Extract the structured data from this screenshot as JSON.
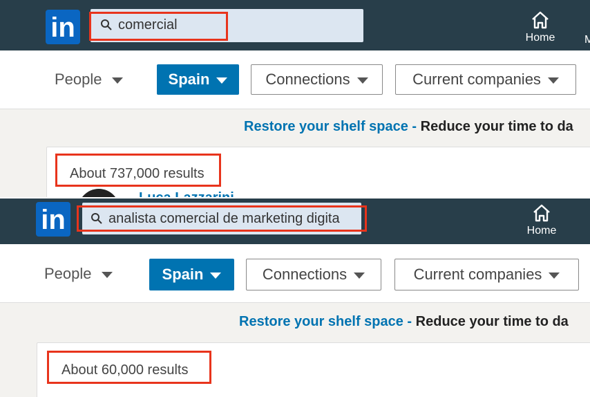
{
  "panels": [
    {
      "logo": "in",
      "search": {
        "query": "comercial"
      },
      "nav": {
        "home_label": "Home",
        "more_label": "M"
      },
      "filters": {
        "people": "People",
        "location": "Spain",
        "connections": "Connections",
        "companies": "Current companies"
      },
      "banner": {
        "link": "Restore your shelf space -",
        "text": "Reduce your time to da"
      },
      "results": {
        "count": "About 737,000 results",
        "first_name": "Luca Lazzarini"
      }
    },
    {
      "logo": "in",
      "search": {
        "query": "analista comercial de marketing digita"
      },
      "nav": {
        "home_label": "Home"
      },
      "filters": {
        "people": "People",
        "location": "Spain",
        "connections": "Connections",
        "companies": "Current companies"
      },
      "banner": {
        "link": "Restore your shelf space -",
        "text": "Reduce your time to da"
      },
      "results": {
        "count": "About 60,000 results"
      }
    }
  ],
  "colors": {
    "navbar": "#283e4a",
    "brand": "#0a66c2",
    "primary": "#0073b1",
    "highlight": "#e8341c"
  },
  "icons": [
    "search-icon",
    "home-icon",
    "chevron-down-icon"
  ]
}
